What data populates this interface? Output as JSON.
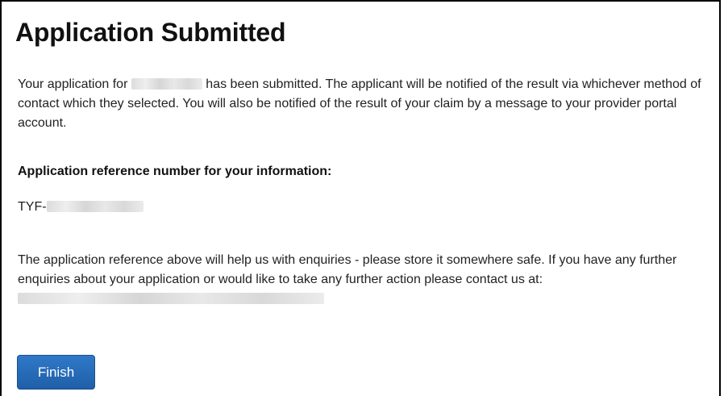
{
  "page": {
    "title": "Application Submitted"
  },
  "message": {
    "intro_before": "Your application for",
    "intro_after": "has been submitted. The applicant will be notified of the result via whichever method of contact which they selected. You will also be notified of the result of your claim by a message to your provider portal account."
  },
  "reference": {
    "label": "Application reference number for your information:",
    "prefix": "TYF-"
  },
  "help": {
    "text_line1": "The application reference above will help us with enquiries - please store it somewhere safe.",
    "text_line2": "If you have any further enquiries about your application or would like to take any further action please contact us at:"
  },
  "actions": {
    "finish_label": "Finish"
  }
}
